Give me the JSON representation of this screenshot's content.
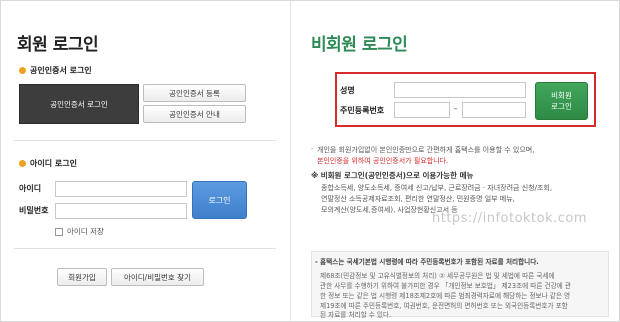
{
  "member_login": {
    "title": "회원 로그인",
    "cert_section_label": "공인인증서 로그인",
    "cert_login_button": "공인인증서 로그인",
    "cert_register_button": "공인인증서 등록",
    "cert_guide_button": "공인인증서 안내",
    "id_section_label": "아이디 로그인",
    "id_label": "아이디",
    "id_value": "",
    "password_label": "비밀번호",
    "password_value": "",
    "login_button": "로그인",
    "save_id_label": "아이디 저장",
    "signup_button": "회원가입",
    "find_button": "아이디/비밀번호 찾기"
  },
  "nonmember_login": {
    "title": "비회원 로그인",
    "name_label": "성명",
    "name_value": "",
    "rrn_label": "주민등록번호",
    "rrn_front_value": "",
    "rrn_hyphen": "-",
    "rrn_back_value": "",
    "button_line1": "비회원",
    "button_line2": "로그인"
  },
  "notes": {
    "line1": "개인을 회원가입없이 본인인증만으로 간편하게 홈택스를 이용할 수 있으며,",
    "line2": "본인인증을 위하여 공인인증서가 필요합니다.",
    "heading": "비회원 로그인(공인인증서)으로 이용가능한 메뉴",
    "menu1": "종합소득세, 양도소득세, 증여세 신고/납부, 근로장려금 · 자녀장려금 신청/조회,",
    "menu2": "연말정산 소득공제자료조회, 편리한 연말정산, 민원증명 일부 메뉴,",
    "menu3": "모의계산(양도세,증여세), 사업장현황신고서 등"
  },
  "infobox": {
    "line1": "홈택스는 국세기본법 시행령에 따라 주민등록번호가 포함된 자료를 처리합니다.",
    "line2": "제68조(민감정보 및 고유식별정보의 처리) ② 세무공무원은 법 및 세법에 따른 국세에",
    "line3": "관한 사무를 수행하기 위하여 불가피한 경우 「개인정보 보호법」 제23조에 따른 건강에 관",
    "line4": "한 정보 또는 같은 법 시행령 제18조제2호에 따른 범죄경력자료에 해당하는 정보나 같은 영",
    "line5": "제19조에 따른 주민등록번호, 여권번호, 운전면허의 면허번호 또는 외국인등록번호가 포함",
    "line6": "된 자료를 처리할 수 있다."
  },
  "watermark": "https://infotoktok.com",
  "colors": {
    "accent_orange": "#f0a020",
    "login_blue": "#4a8bd6",
    "nonmember_green": "#34984f",
    "highlight_red": "#d62b2b",
    "title_green": "#2e8b57"
  }
}
